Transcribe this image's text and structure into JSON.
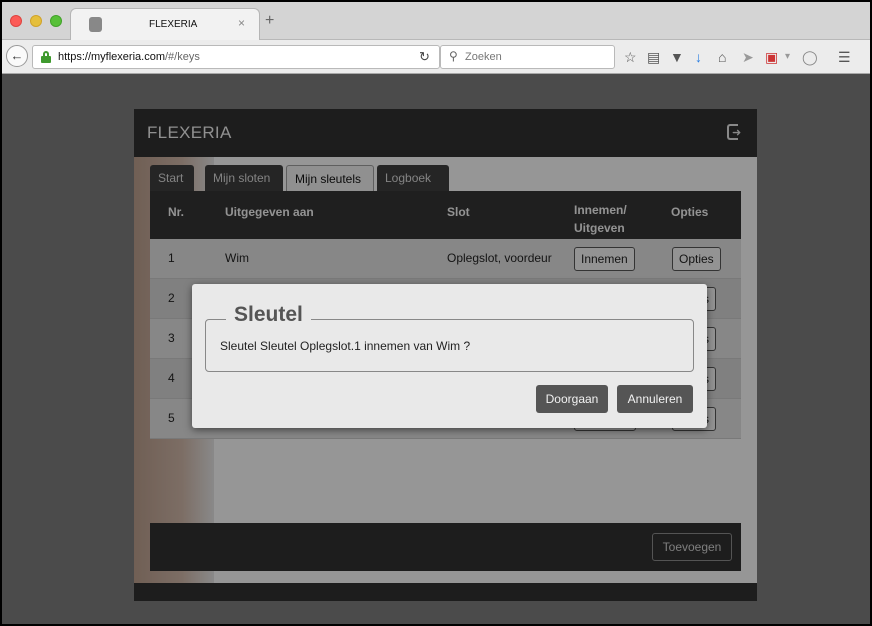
{
  "browser": {
    "tab_title": "FLEXERIA",
    "tab_close": "×",
    "new_tab": "+",
    "url_domain": "https://myflexeria.com",
    "url_path": "/#/keys",
    "search_placeholder": "Zoeken"
  },
  "app": {
    "title": "FLEXERIA",
    "tabs": [
      {
        "label": "Start",
        "active": false
      },
      {
        "label": "Mijn sloten",
        "active": false
      },
      {
        "label": "Mijn sleutels",
        "active": true
      },
      {
        "label": "Logboek",
        "active": false
      }
    ],
    "table": {
      "headers": {
        "nr": "Nr.",
        "issued_to": "Uitgegeven aan",
        "lock": "Slot",
        "take_in_line1": "Innemen/",
        "take_in_line2": "Uitgeven",
        "options": "Opties"
      },
      "rows": [
        {
          "nr": "1",
          "issued_to": "Wim",
          "lock": "Oplegslot, voordeur",
          "action": "Innemen",
          "options": "Opties"
        },
        {
          "nr": "2",
          "issued_to": "",
          "lock": "",
          "action": "",
          "options": "s"
        },
        {
          "nr": "3",
          "issued_to": "",
          "lock": "",
          "action": "",
          "options": "s"
        },
        {
          "nr": "4",
          "issued_to": "",
          "lock": "",
          "action": "",
          "options": "s"
        },
        {
          "nr": "5",
          "issued_to": "",
          "lock": "",
          "action": "",
          "options": "s"
        }
      ]
    },
    "add_button": "Toevoegen"
  },
  "modal": {
    "legend": "Sleutel",
    "message": "Sleutel Sleutel Oplegslot.1 innemen van Wim ?",
    "continue_button": "Doorgaan",
    "cancel_button": "Annuleren"
  },
  "colors": {
    "header_bg": "#2f2f2f",
    "button_bg": "#555555",
    "lock_green": "#3f9a2e"
  }
}
